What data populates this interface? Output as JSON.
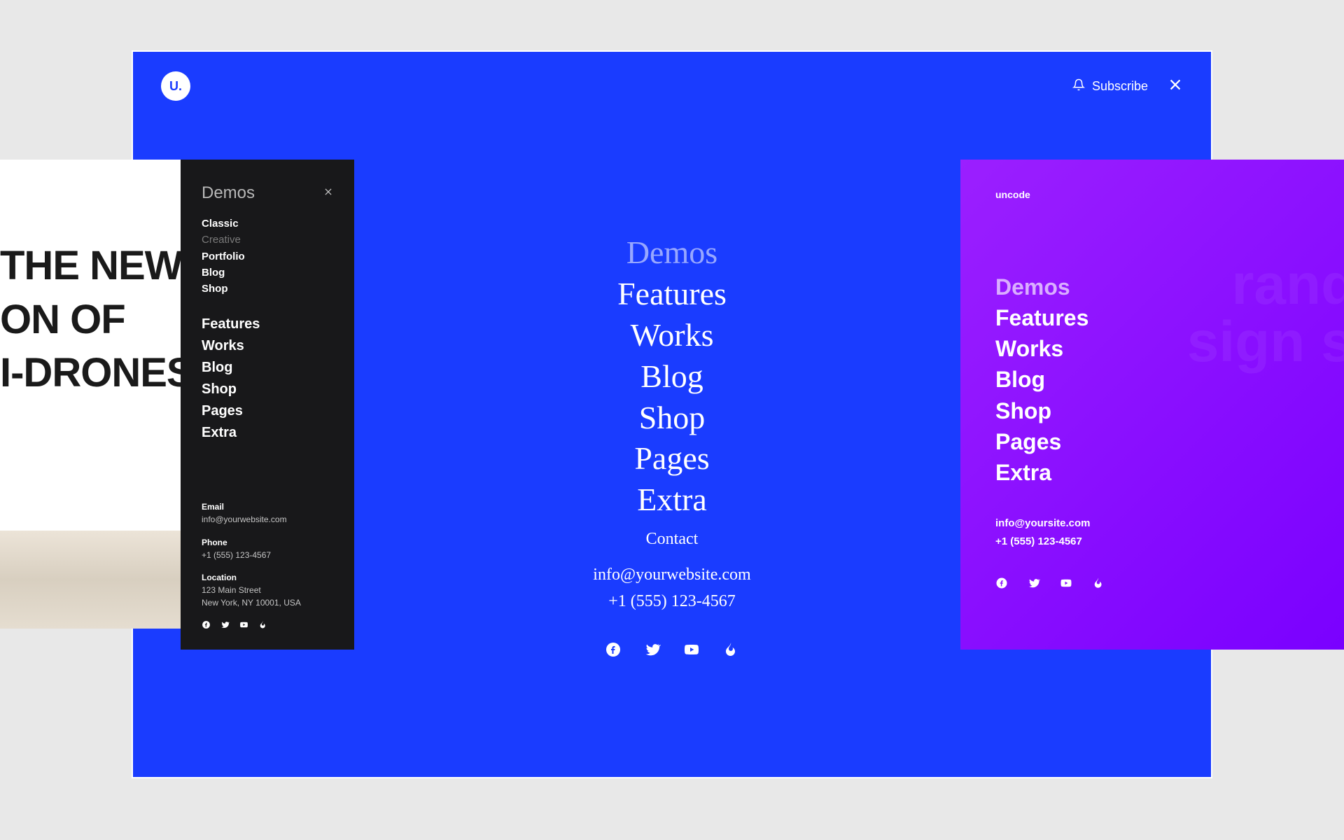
{
  "main": {
    "logo_text": "U.",
    "subscribe_label": "Subscribe",
    "menu": [
      "Demos",
      "Features",
      "Works",
      "Blog",
      "Shop",
      "Pages",
      "Extra"
    ],
    "contact_heading": "Contact",
    "contact_email": "info@yourwebsite.com",
    "contact_phone": "+1 (555) 123-4567"
  },
  "left_hero": {
    "line1": "THE NEW",
    "line2": "ON OF",
    "line3": "I-DRONES"
  },
  "dark": {
    "title": "Demos",
    "sub_items": [
      {
        "label": "Classic",
        "bold": true
      },
      {
        "label": "Creative",
        "dim": true
      },
      {
        "label": "Portfolio",
        "bold": true
      },
      {
        "label": "Blog",
        "bold": true
      },
      {
        "label": "Shop",
        "bold": true
      }
    ],
    "main_items": [
      "Features",
      "Works",
      "Blog",
      "Shop",
      "Pages",
      "Extra"
    ],
    "footer": {
      "email_label": "Email",
      "email_value": "info@yourwebsite.com",
      "phone_label": "Phone",
      "phone_value": "+1 (555) 123-4567",
      "location_label": "Location",
      "location_value1": "123 Main Street",
      "location_value2": "New York, NY 10001, USA"
    }
  },
  "purple": {
    "logo": "uncode",
    "menu": [
      "Demos",
      "Features",
      "Works",
      "Blog",
      "Shop",
      "Pages",
      "Extra"
    ],
    "contact_email": "info@yoursite.com",
    "contact_phone": "+1 (555) 123-4567",
    "bg_text1": "randi",
    "bg_text2": "sign st"
  }
}
